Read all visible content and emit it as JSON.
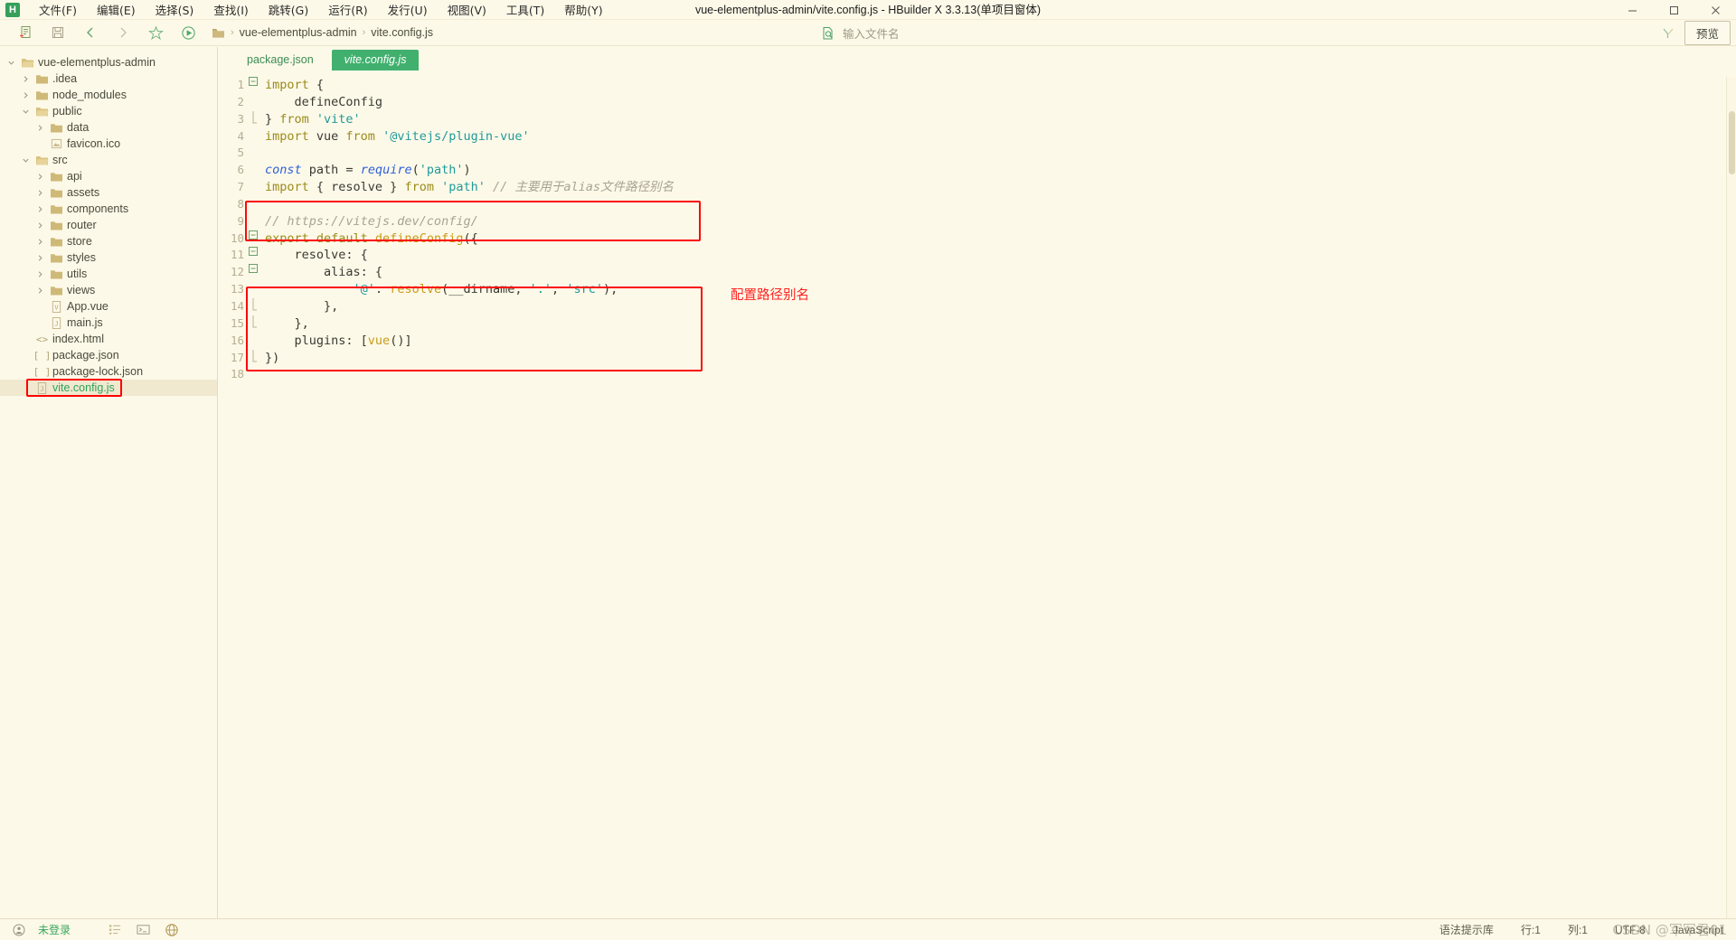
{
  "window": {
    "title": "vue-elementplus-admin/vite.config.js - HBuilder X 3.3.13(单项目窗体)",
    "logo": "H",
    "minimize": "—",
    "maximize": "❐",
    "close": "✕"
  },
  "menubar": [
    {
      "label": "文件(F)",
      "name": "menu-file"
    },
    {
      "label": "编辑(E)",
      "name": "menu-edit"
    },
    {
      "label": "选择(S)",
      "name": "menu-select"
    },
    {
      "label": "查找(I)",
      "name": "menu-find"
    },
    {
      "label": "跳转(G)",
      "name": "menu-goto"
    },
    {
      "label": "运行(R)",
      "name": "menu-run"
    },
    {
      "label": "发行(U)",
      "name": "menu-publish"
    },
    {
      "label": "视图(V)",
      "name": "menu-view"
    },
    {
      "label": "工具(T)",
      "name": "menu-tools"
    },
    {
      "label": "帮助(Y)",
      "name": "menu-help"
    }
  ],
  "toolbar": {
    "icons": [
      "new-file-icon",
      "save-icon",
      "back-icon",
      "forward-icon",
      "star-icon",
      "run-icon"
    ],
    "breadcrumb": {
      "project": "vue-elementplus-admin",
      "file": "vite.config.js",
      "separator": "›"
    },
    "file_search_placeholder": "输入文件名",
    "filter_icon": "filter-icon",
    "preview_label": "预览"
  },
  "sidebar": {
    "tree": [
      {
        "label": "vue-elementplus-admin",
        "depth": 0,
        "twisty": "expanded",
        "icon": "folder-open-icon",
        "selected": false
      },
      {
        "label": ".idea",
        "depth": 1,
        "twisty": "collapsed",
        "icon": "folder-icon",
        "selected": false
      },
      {
        "label": "node_modules",
        "depth": 1,
        "twisty": "collapsed",
        "icon": "folder-icon",
        "selected": false
      },
      {
        "label": "public",
        "depth": 1,
        "twisty": "expanded",
        "icon": "folder-open-icon",
        "selected": false
      },
      {
        "label": "data",
        "depth": 2,
        "twisty": "collapsed",
        "icon": "folder-icon",
        "selected": false
      },
      {
        "label": "favicon.ico",
        "depth": 2,
        "twisty": "none",
        "icon": "image-file-icon",
        "selected": false
      },
      {
        "label": "src",
        "depth": 1,
        "twisty": "expanded",
        "icon": "folder-open-icon",
        "selected": false
      },
      {
        "label": "api",
        "depth": 2,
        "twisty": "collapsed",
        "icon": "folder-icon",
        "selected": false
      },
      {
        "label": "assets",
        "depth": 2,
        "twisty": "collapsed",
        "icon": "folder-icon",
        "selected": false
      },
      {
        "label": "components",
        "depth": 2,
        "twisty": "collapsed",
        "icon": "folder-icon",
        "selected": false
      },
      {
        "label": "router",
        "depth": 2,
        "twisty": "collapsed",
        "icon": "folder-icon",
        "selected": false
      },
      {
        "label": "store",
        "depth": 2,
        "twisty": "collapsed",
        "icon": "folder-icon",
        "selected": false
      },
      {
        "label": "styles",
        "depth": 2,
        "twisty": "collapsed",
        "icon": "folder-icon",
        "selected": false
      },
      {
        "label": "utils",
        "depth": 2,
        "twisty": "collapsed",
        "icon": "folder-icon",
        "selected": false
      },
      {
        "label": "views",
        "depth": 2,
        "twisty": "collapsed",
        "icon": "folder-icon",
        "selected": false
      },
      {
        "label": "App.vue",
        "depth": 2,
        "twisty": "none",
        "icon": "vue-file-icon",
        "selected": false
      },
      {
        "label": "main.js",
        "depth": 2,
        "twisty": "none",
        "icon": "js-file-icon",
        "selected": false
      },
      {
        "label": "index.html",
        "depth": 1,
        "twisty": "none",
        "icon": "html-file-icon",
        "selected": false
      },
      {
        "label": "package.json",
        "depth": 1,
        "twisty": "none",
        "icon": "json-file-icon",
        "selected": false
      },
      {
        "label": "package-lock.json",
        "depth": 1,
        "twisty": "none",
        "icon": "json-file-icon",
        "selected": false
      },
      {
        "label": "vite.config.js",
        "depth": 1,
        "twisty": "none",
        "icon": "js-file-icon",
        "selected": true
      }
    ]
  },
  "editor": {
    "tabs": [
      {
        "label": "package.json",
        "active": false
      },
      {
        "label": "vite.config.js",
        "active": true
      }
    ],
    "lines": [
      {
        "num": "1",
        "fold": "minus",
        "tokens": [
          {
            "t": "import ",
            "c": "kw"
          },
          {
            "t": "{",
            "c": "punc"
          }
        ]
      },
      {
        "num": "2",
        "fold": "",
        "tokens": [
          {
            "t": "    defineConfig",
            "c": "plain"
          }
        ]
      },
      {
        "num": "3",
        "fold": "end",
        "tokens": [
          {
            "t": "} ",
            "c": "punc"
          },
          {
            "t": "from ",
            "c": "kw"
          },
          {
            "t": "'vite'",
            "c": "str"
          }
        ]
      },
      {
        "num": "4",
        "fold": "",
        "tokens": [
          {
            "t": "import ",
            "c": "kw"
          },
          {
            "t": "vue ",
            "c": "plain"
          },
          {
            "t": "from ",
            "c": "kw"
          },
          {
            "t": "'@vitejs/plugin-vue'",
            "c": "str"
          }
        ]
      },
      {
        "num": "5",
        "fold": "",
        "tokens": []
      },
      {
        "num": "6",
        "fold": "",
        "tokens": [
          {
            "t": "const ",
            "c": "kw2"
          },
          {
            "t": "path ",
            "c": "plain"
          },
          {
            "t": "= ",
            "c": "punc"
          },
          {
            "t": "require",
            "c": "kw2"
          },
          {
            "t": "(",
            "c": "punc"
          },
          {
            "t": "'path'",
            "c": "str"
          },
          {
            "t": ")",
            "c": "punc"
          }
        ]
      },
      {
        "num": "7",
        "fold": "",
        "tokens": [
          {
            "t": "import ",
            "c": "kw"
          },
          {
            "t": "{ resolve } ",
            "c": "punc"
          },
          {
            "t": "from ",
            "c": "kw"
          },
          {
            "t": "'path' ",
            "c": "str"
          },
          {
            "t": "// 主要用于alias文件路径别名",
            "c": "cmt"
          }
        ]
      },
      {
        "num": "8",
        "fold": "",
        "tokens": []
      },
      {
        "num": "9",
        "fold": "",
        "tokens": [
          {
            "t": "// https://vitejs.dev/config/",
            "c": "cmt"
          }
        ]
      },
      {
        "num": "10",
        "fold": "minus",
        "tokens": [
          {
            "t": "export default ",
            "c": "kw"
          },
          {
            "t": "defineConfig",
            "c": "fn"
          },
          {
            "t": "({",
            "c": "punc"
          }
        ]
      },
      {
        "num": "11",
        "fold": "minus",
        "tokens": [
          {
            "t": "    resolve: {",
            "c": "plain"
          }
        ]
      },
      {
        "num": "12",
        "fold": "minus",
        "tokens": [
          {
            "t": "        alias: {",
            "c": "plain"
          }
        ]
      },
      {
        "num": "13",
        "fold": "",
        "tokens": [
          {
            "t": "            ",
            "c": "plain"
          },
          {
            "t": "'@'",
            "c": "str"
          },
          {
            "t": ": ",
            "c": "punc"
          },
          {
            "t": "resolve",
            "c": "fn"
          },
          {
            "t": "(__dirname, ",
            "c": "punc"
          },
          {
            "t": "'.'",
            "c": "str"
          },
          {
            "t": ", ",
            "c": "punc"
          },
          {
            "t": "'src'",
            "c": "str"
          },
          {
            "t": "),",
            "c": "punc"
          }
        ]
      },
      {
        "num": "14",
        "fold": "end",
        "tokens": [
          {
            "t": "        },",
            "c": "punc"
          }
        ]
      },
      {
        "num": "15",
        "fold": "end",
        "tokens": [
          {
            "t": "    },",
            "c": "punc"
          }
        ]
      },
      {
        "num": "16",
        "fold": "",
        "tokens": [
          {
            "t": "    plugins: [",
            "c": "plain"
          },
          {
            "t": "vue",
            "c": "fn"
          },
          {
            "t": "()]",
            "c": "punc"
          }
        ]
      },
      {
        "num": "17",
        "fold": "end",
        "tokens": [
          {
            "t": "})",
            "c": "punc"
          }
        ]
      },
      {
        "num": "18",
        "fold": "",
        "tokens": []
      }
    ],
    "annotation": "配置路径别名"
  },
  "statusbar": {
    "account": "未登录",
    "icons": [
      "outline-icon",
      "terminal-icon",
      "globe-icon"
    ],
    "grammar_library": "语法提示库",
    "line": "行:1",
    "column": "列:1",
    "encoding": "UTF-8",
    "language": "JavaScript",
    "watermark": "CSDN @军军君01"
  },
  "colors": {
    "background": "#fdf9e8",
    "accent_green": "#41b06e",
    "annotation_red": "#fa0a0a",
    "string_teal": "#1f9a9a",
    "keyword_olive": "#9a8b1a"
  }
}
